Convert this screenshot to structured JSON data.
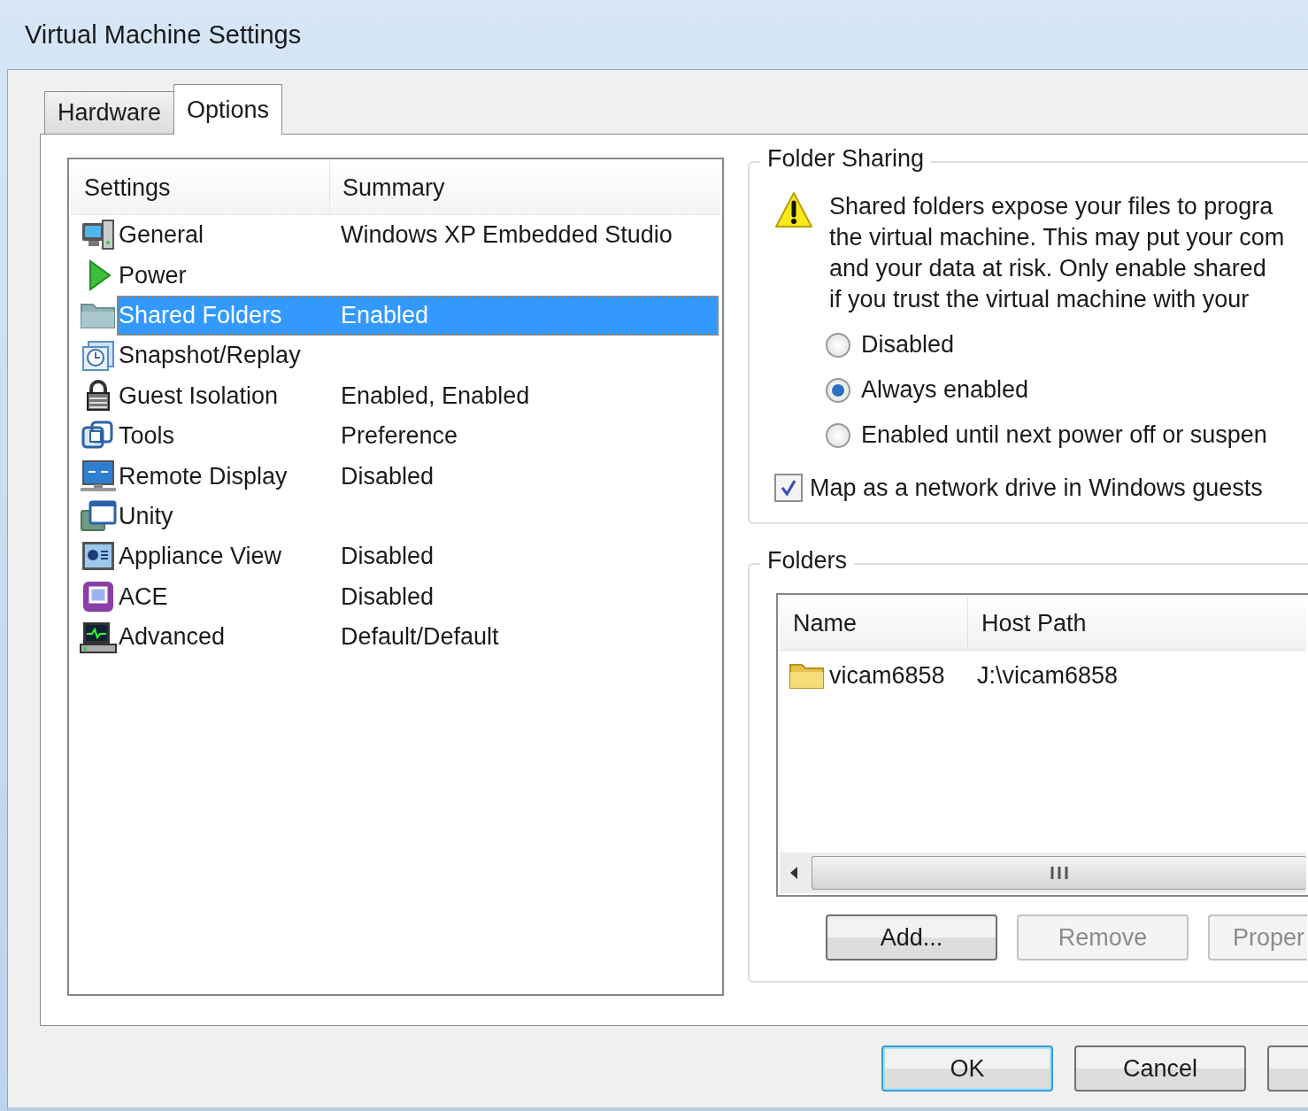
{
  "window": {
    "title": "Virtual Machine Settings"
  },
  "tabs": [
    {
      "label": "Hardware",
      "selected": false
    },
    {
      "label": "Options",
      "selected": true
    }
  ],
  "settings_list": {
    "columns": [
      "Settings",
      "Summary"
    ],
    "rows": [
      {
        "name": "General",
        "summary": "Windows XP Embedded Studio",
        "selected": false
      },
      {
        "name": "Power",
        "selected": false
      },
      {
        "name": "Shared Folders",
        "summary": "Enabled",
        "selected": true
      },
      {
        "name": "Snapshot/Replay",
        "selected": false
      },
      {
        "name": "Guest Isolation",
        "summary": "Enabled, Enabled",
        "selected": false
      },
      {
        "name": "Tools",
        "summary": "Preference",
        "selected": false
      },
      {
        "name": "Remote Display",
        "summary": "Disabled",
        "selected": false
      },
      {
        "name": "Unity",
        "selected": false
      },
      {
        "name": "Appliance View",
        "summary": "Disabled",
        "selected": false
      },
      {
        "name": "ACE",
        "summary": "Disabled",
        "selected": false
      },
      {
        "name": "Advanced",
        "summary": "Default/Default",
        "selected": false
      }
    ]
  },
  "folder_sharing": {
    "title": "Folder Sharing",
    "warning": "Shared folders expose your files to progra\nthe virtual machine. This may put your com\nand your data at risk. Only enable shared\nif you trust the virtual machine with your",
    "options": [
      {
        "label": "Disabled",
        "selected": false
      },
      {
        "label": "Always enabled",
        "selected": true
      },
      {
        "label": "Enabled until next power off or suspen",
        "selected": false
      }
    ],
    "map_drive": {
      "label": "Map as a network drive in Windows guests",
      "checked": true
    }
  },
  "folders": {
    "title": "Folders",
    "columns": [
      "Name",
      "Host Path"
    ],
    "rows": [
      {
        "name": "vicam6858",
        "host_path": "J:\\vicam6858"
      }
    ],
    "buttons": [
      {
        "label": "Add...",
        "disabled": false
      },
      {
        "label": "Remove",
        "disabled": true
      },
      {
        "label": "Proper",
        "disabled": true
      }
    ]
  },
  "buttons": [
    {
      "label": "OK",
      "default": true
    },
    {
      "label": "Cancel",
      "default": false
    }
  ]
}
